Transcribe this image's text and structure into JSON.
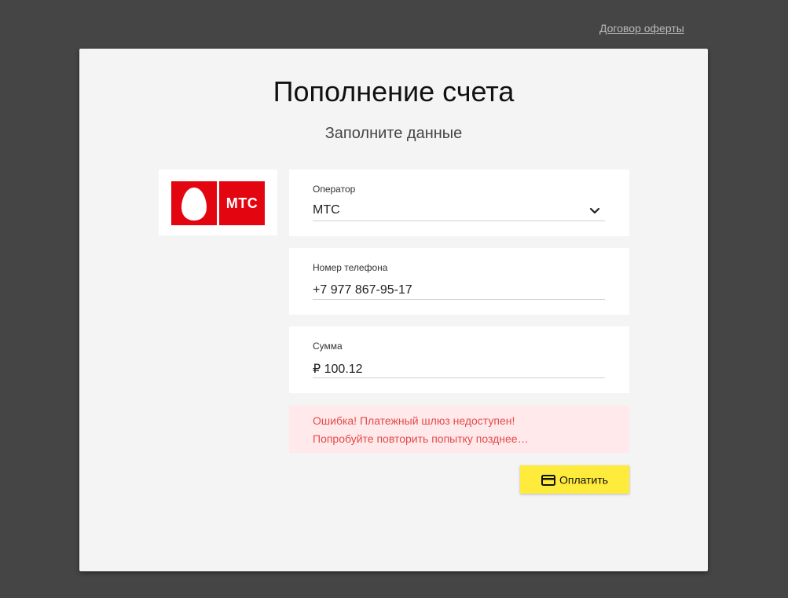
{
  "header": {
    "offer_link": "Договор оферты"
  },
  "page": {
    "title": "Пополнение счета",
    "subtitle": "Заполните данные"
  },
  "logo": {
    "text": "МТС",
    "brand_color": "#e30611"
  },
  "form": {
    "operator": {
      "label": "Оператор",
      "value": "МТС"
    },
    "phone": {
      "label": "Номер телефона",
      "value": "+7 977 867-95-17"
    },
    "amount": {
      "label": "Сумма",
      "value": "₽ 100.12"
    }
  },
  "error": {
    "line1": "Ошибка! Платежный шлюз недоступен!",
    "line2": "Попробуйте повторить попытку позднее…",
    "color": "#e54a4a",
    "background": "#ffe9ea"
  },
  "pay_button": {
    "label": "Оплатить",
    "icon": "credit-card-icon",
    "color": "#ffeb3b"
  }
}
